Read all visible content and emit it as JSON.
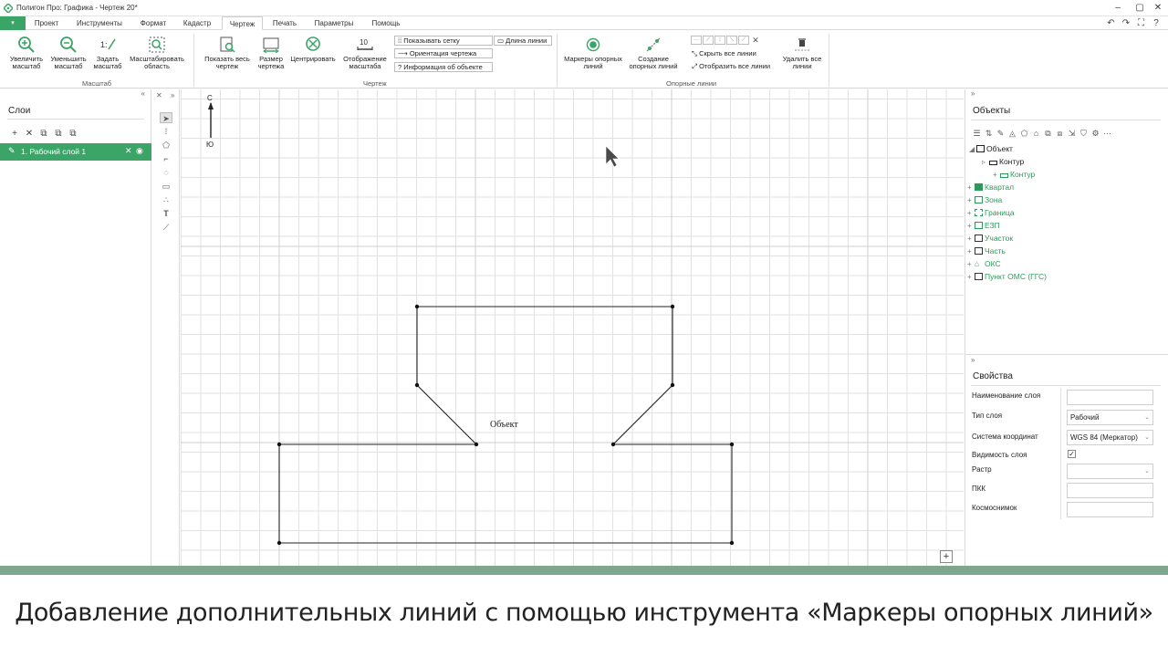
{
  "window": {
    "title": "Полигон Про: Графика - Чертеж 20*",
    "controls": {
      "minimize": "–",
      "maximize": "▢",
      "close": "✕"
    }
  },
  "menu": {
    "file_label": "▾",
    "tabs": [
      {
        "label": "Проект"
      },
      {
        "label": "Инструменты"
      },
      {
        "label": "Формат"
      },
      {
        "label": "Кадастр"
      },
      {
        "label": "Чертеж"
      },
      {
        "label": "Печать"
      },
      {
        "label": "Параметры"
      },
      {
        "label": "Помощь"
      }
    ],
    "active_tab": "Чертеж",
    "quick": {
      "undo": "↶",
      "redo": "↷",
      "fit": "⛶",
      "help": "?"
    }
  },
  "ribbon": {
    "groups": {
      "scale": "Масштаб",
      "drawing": "Чертеж",
      "support_lines": "Опорные линии"
    },
    "buttons": {
      "zoom_in": "Увеличить масштаб",
      "zoom_out": "Уменьшить масштаб",
      "set_scale": "Задать масштаб",
      "scale_area": "Масштабировать область",
      "show_all": "Показать весь чертеж",
      "drawing_size": "Размер чертежа",
      "center": "Центрировать",
      "scale_display": "Отображение масштаба",
      "show_grid": "Показывать сетку",
      "orientation": "Ориентация чертежа",
      "object_info": "Информация об объекте",
      "line_length": "Длина линии",
      "markers": "Маркеры опорных линий",
      "create_lines": "Создание опорных линий",
      "hide_all": "Скрыть все линии",
      "show_all_lines": "Отобразить все линии",
      "delete_lines": "Удалить все линии"
    }
  },
  "layers_panel": {
    "title": "Слои",
    "collapse": "«",
    "layers": [
      {
        "label": "1.   Рабочий слой 1"
      }
    ]
  },
  "toolstrip": {
    "close": "✕",
    "expand": "»"
  },
  "canvas": {
    "north": "С",
    "south": "Ю",
    "object_label": "Объект",
    "add_button": "+"
  },
  "objects_panel": {
    "title": "Объекты",
    "collapse": "»",
    "tree": [
      {
        "label": "Объект"
      },
      {
        "label": "Контур"
      },
      {
        "label": "Контур"
      },
      {
        "label": "Квартал"
      },
      {
        "label": "Зона"
      },
      {
        "label": "Граница"
      },
      {
        "label": "ЕЗП"
      },
      {
        "label": "Участок"
      },
      {
        "label": "Часть"
      },
      {
        "label": "ОКС"
      },
      {
        "label": "Пункт ОМС (ГГС)"
      }
    ]
  },
  "properties_panel": {
    "title": "Свойства",
    "collapse": "»",
    "rows": [
      {
        "label": "Наименование слоя",
        "value": ""
      },
      {
        "label": "Тип слоя",
        "value": "Рабочий"
      },
      {
        "label": "Система координат",
        "value": "WGS 84 (Меркатор)"
      },
      {
        "label": "Видимость слоя",
        "value": "✓"
      },
      {
        "label": "Растр",
        "value": ""
      },
      {
        "label": "ПКК",
        "value": ""
      },
      {
        "label": "Космоснимок",
        "value": ""
      }
    ]
  },
  "caption": "Добавление дополнительных линий с помощью инструмента «Маркеры опорных линий»",
  "colors": {
    "accent": "#3aa567",
    "bottom_bar": "#7fa78e",
    "tree_green": "#2d9a5b"
  }
}
